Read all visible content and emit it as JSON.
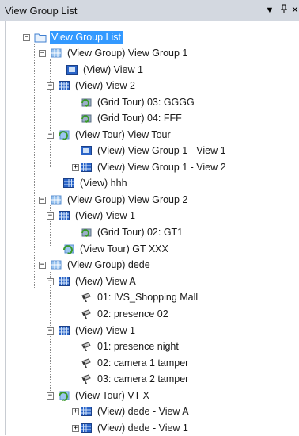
{
  "panel": {
    "title": "View Group List",
    "menu_glyph": "▼",
    "pin_glyph": "ᵖ",
    "close_glyph": "✕"
  },
  "tree": {
    "root": "View Group List",
    "items": [
      {
        "label": "(View Group) View Group 1",
        "icon": "view-group-icon"
      },
      {
        "label": "(View) View 1",
        "icon": "view-single-icon"
      },
      {
        "label": "(View) View 2",
        "icon": "view-grid-icon"
      },
      {
        "label": "(Grid Tour) 03: GGGG",
        "icon": "grid-tour-icon"
      },
      {
        "label": "(Grid Tour) 04: FFF",
        "icon": "grid-tour-icon"
      },
      {
        "label": "(View Tour) View Tour",
        "icon": "view-tour-icon"
      },
      {
        "label": "(View) View Group 1 - View 1",
        "icon": "view-single-icon"
      },
      {
        "label": "(View) View Group 1 - View 2",
        "icon": "view-grid-icon"
      },
      {
        "label": "(View) hhh",
        "icon": "view-grid-icon"
      },
      {
        "label": "(View Group) View Group 2",
        "icon": "view-group-icon"
      },
      {
        "label": "(View) View 1",
        "icon": "view-grid-icon"
      },
      {
        "label": "(Grid Tour) 02: GT1",
        "icon": "grid-tour-icon"
      },
      {
        "label": "(View Tour) GT XXX",
        "icon": "view-tour-icon"
      },
      {
        "label": "(View Group) dede",
        "icon": "view-group-icon"
      },
      {
        "label": "(View) View A",
        "icon": "view-grid-icon"
      },
      {
        "label": "01: IVS_Shopping Mall",
        "icon": "camera-icon"
      },
      {
        "label": "02: presence 02",
        "icon": "camera-icon"
      },
      {
        "label": "(View) View 1",
        "icon": "view-grid-icon"
      },
      {
        "label": "01: presence night",
        "icon": "camera-icon"
      },
      {
        "label": "02: camera 1 tamper",
        "icon": "camera-icon"
      },
      {
        "label": "03: camera 2 tamper",
        "icon": "camera-icon"
      },
      {
        "label": "(View Tour) VT X",
        "icon": "view-tour-icon"
      },
      {
        "label": "(View) dede - View A",
        "icon": "view-grid-icon"
      },
      {
        "label": "(View) dede - View 1",
        "icon": "view-grid-icon"
      }
    ]
  },
  "colors": {
    "selection": "#3399ff",
    "titlebar": "#d3d8e0",
    "icon_blue": "#2a64c8",
    "folder": "#7fb2e8",
    "tour_green": "#3a9a2a"
  }
}
